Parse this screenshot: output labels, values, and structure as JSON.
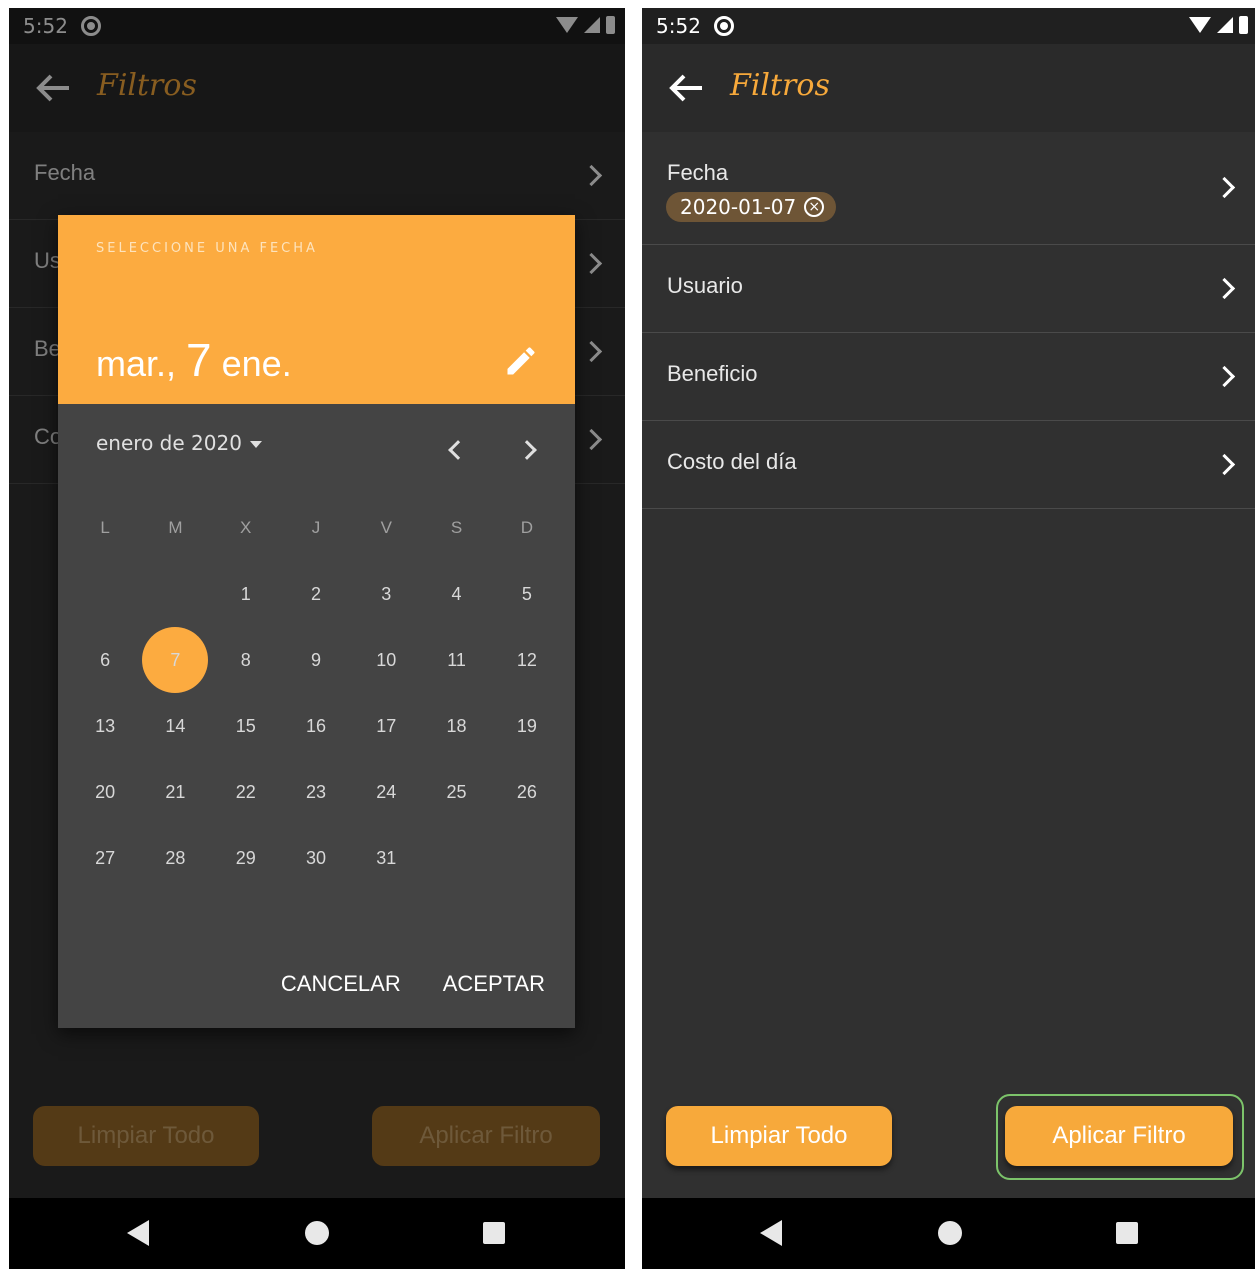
{
  "status": {
    "time": "5:52"
  },
  "appbar": {
    "title": "Filtros"
  },
  "left": {
    "items": [
      {
        "label": "Fecha"
      },
      {
        "label": "Us"
      },
      {
        "label": "Be"
      },
      {
        "label": "Cos"
      }
    ]
  },
  "right": {
    "items": [
      {
        "label": "Fecha",
        "chip": "2020-01-07"
      },
      {
        "label": "Usuario"
      },
      {
        "label": "Beneficio"
      },
      {
        "label": "Costo del día"
      }
    ]
  },
  "buttons": {
    "clear": "Limpiar Todo",
    "apply": "Aplicar Filtro"
  },
  "date_picker": {
    "caption": "SELECCIONE UNA FECHA",
    "selected_weekday": "mar.,",
    "selected_day": "7",
    "selected_month": "ene.",
    "month_year": "enero de 2020",
    "weekdays": [
      "L",
      "M",
      "X",
      "J",
      "V",
      "S",
      "D"
    ],
    "weeks": [
      [
        "",
        "",
        "1",
        "2",
        "3",
        "4",
        "5"
      ],
      [
        "6",
        "7",
        "8",
        "9",
        "10",
        "11",
        "12"
      ],
      [
        "13",
        "14",
        "15",
        "16",
        "17",
        "18",
        "19"
      ],
      [
        "20",
        "21",
        "22",
        "23",
        "24",
        "25",
        "26"
      ],
      [
        "27",
        "28",
        "29",
        "30",
        "31",
        "",
        ""
      ]
    ],
    "selected_date": "7",
    "cancel": "CANCELAR",
    "accept": "ACEPTAR"
  },
  "colors": {
    "accent": "#fcab40",
    "title": "#f7a93b",
    "background": "#303030",
    "focus": "#7cc36a"
  }
}
